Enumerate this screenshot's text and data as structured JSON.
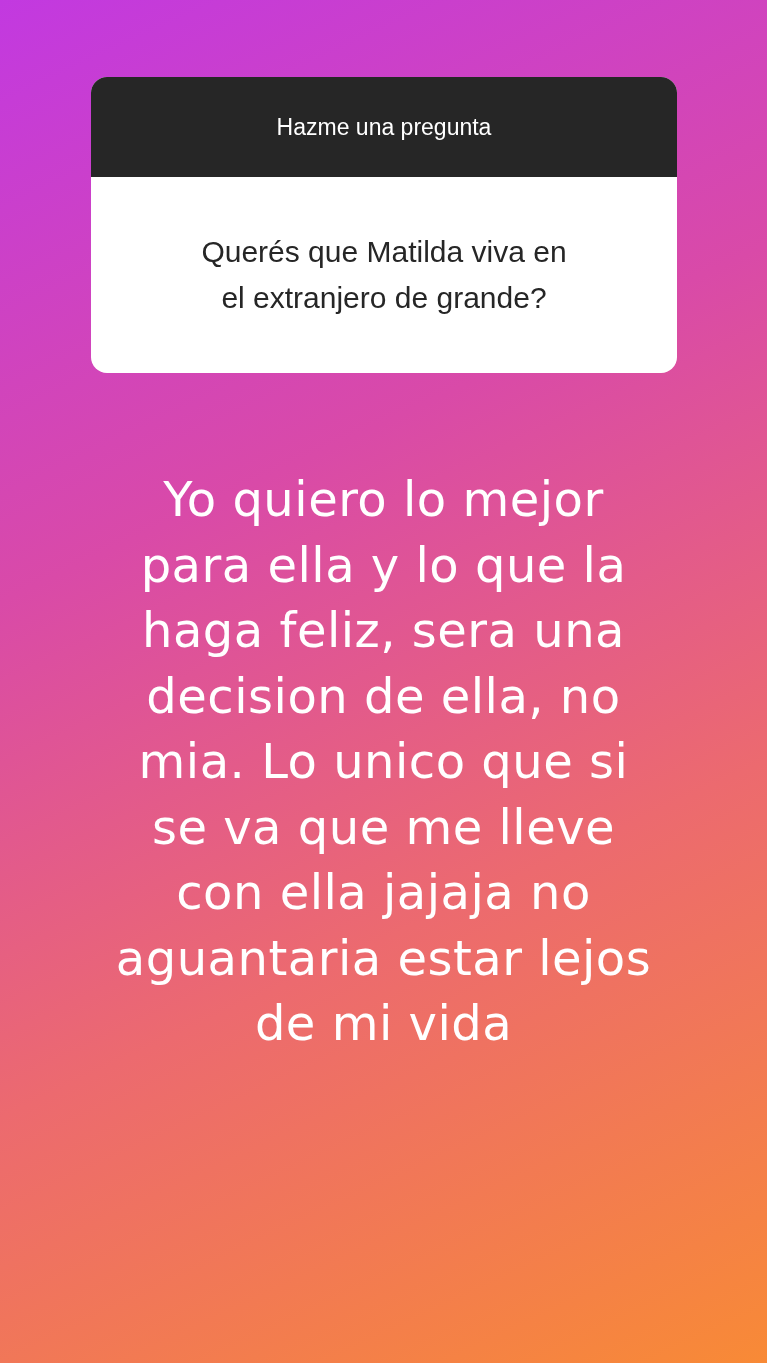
{
  "question_sticker": {
    "header": "Hazme una pregunta",
    "question": "Querés que Matilda viva en\nel extranjero de grande?"
  },
  "answer_text": "Yo quiero lo mejor\npara ella y lo que la\nhaga feliz, sera una\ndecision de ella, no\nmia. Lo unico que si\nse va que me lleve\ncon ella jajaja no\naguantaria estar lejos\nde mi vida"
}
